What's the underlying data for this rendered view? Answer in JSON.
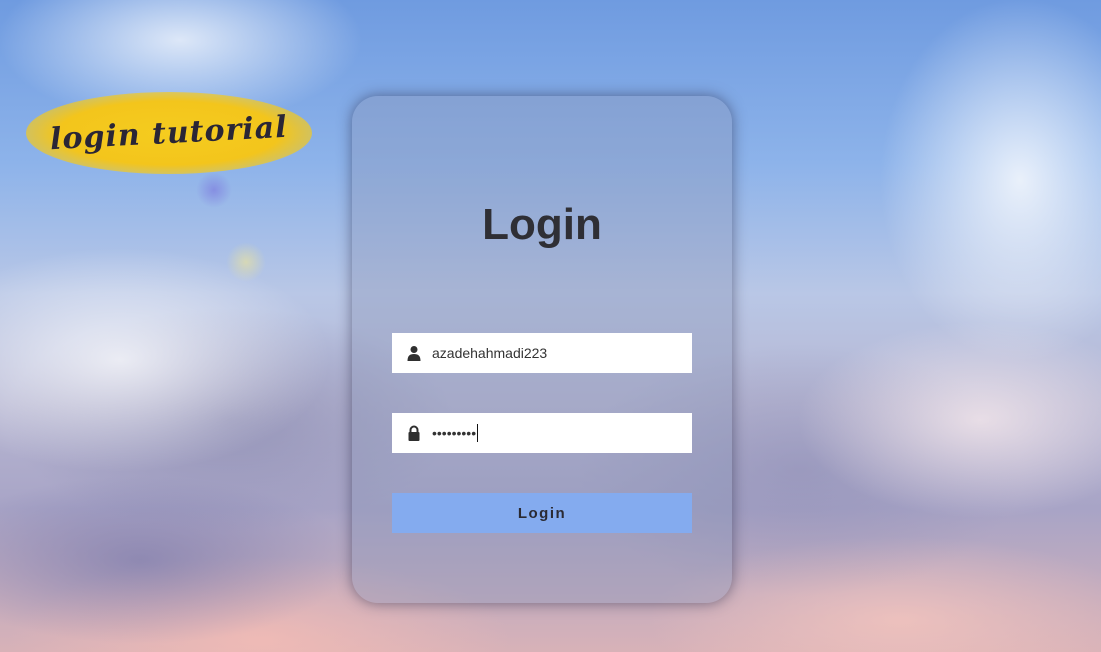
{
  "logo": {
    "text": "login tutorial",
    "accent_color": "#f5cc1f"
  },
  "card": {
    "title": "Login",
    "username": {
      "icon": "user-icon",
      "value": "azadehahmadi223"
    },
    "password": {
      "icon": "lock-icon",
      "masked_value": "•••••••••"
    },
    "submit_label": "Login",
    "button_color": "#84abef"
  }
}
